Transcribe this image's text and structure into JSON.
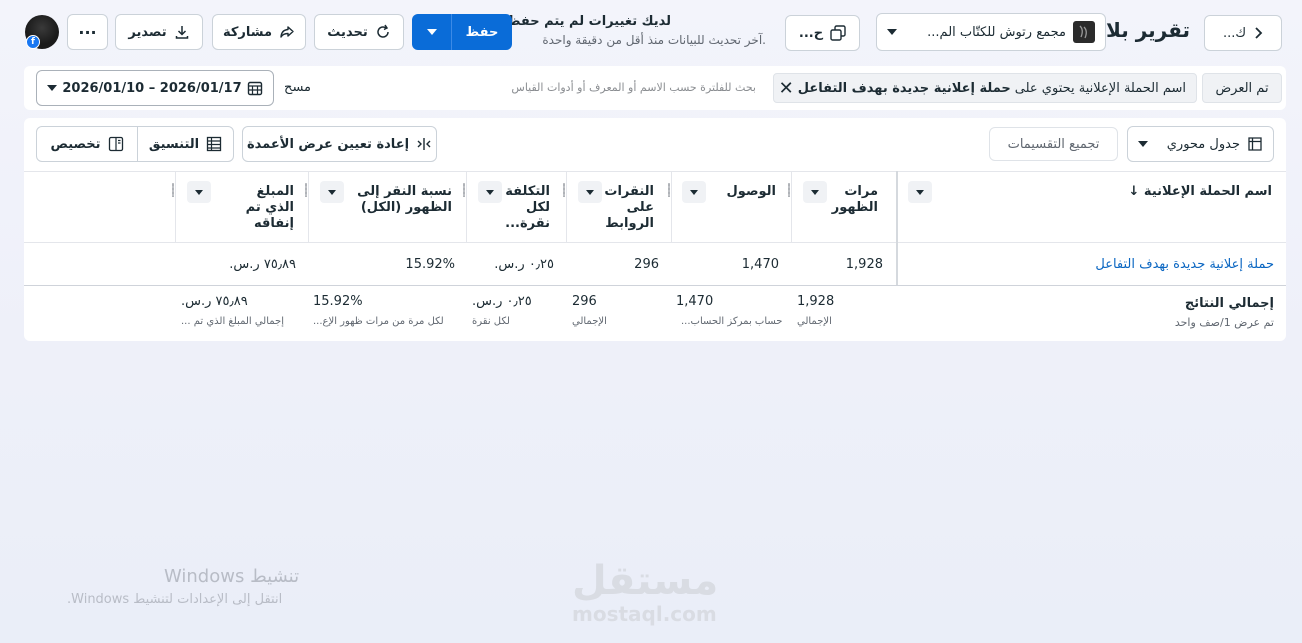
{
  "header": {
    "back_label": "ك...",
    "report_title": "تقرير بلا",
    "account_name": "مجمع رتوش للكتّاب الم...",
    "small_button_label": "ح...",
    "unsaved_title": "لديك تغييرات لم يتم حفظها",
    "unsaved_subtitle": "آخر تحديث للبيانات منذ أقل من دقيقة واحدة.",
    "save_label": "حفظ",
    "refresh_label": "تحديث",
    "share_label": "مشاركة",
    "export_label": "تصدير",
    "more_label": "···",
    "fb_badge": "f"
  },
  "filters": {
    "view_chip": "تم العرض",
    "filter_prefix": "اسم الحملة الإعلانية يحتوي على",
    "filter_value": "حملة إعلانية جديدة بهدف التفاعل",
    "filter_clear": "✕",
    "search_hint": "بحث للفلترة حسب الاسم أو المعرف أو أدوات القياس",
    "clear_label": "مسح",
    "date_range": "2026/01/10 – 2026/01/17"
  },
  "toolbar": {
    "pivot_label": "جدول محوري",
    "breakdown_label": "تجميع التقسيمات",
    "reset_columns_label": "إعادة تعيين عرض الأعمدة",
    "format_label": "التنسيق",
    "customize_label": "تخصيص"
  },
  "table": {
    "columns": [
      {
        "label": "اسم الحملة الإعلانية ↓"
      },
      {
        "label": "مرات الظهور"
      },
      {
        "label": "الوصول"
      },
      {
        "label": "النقرات على الروابط"
      },
      {
        "label": "التكلفة لكل نقرة..."
      },
      {
        "label": "نسبة النقر إلى الظهور (الكل)"
      },
      {
        "label": "المبلغ الذي تم إنفاقه"
      }
    ],
    "rows": [
      {
        "campaign": "حملة إعلانية جديدة بهدف التفاعل",
        "impressions": "1,928",
        "reach": "1,470",
        "link_clicks": "296",
        "cpc": "٠٫٢٥ ر.س.",
        "ctr": "15.92%",
        "spent": "٧٥٫٨٩ ر.س."
      }
    ],
    "totals": {
      "title": "إجمالي النتائج",
      "subtitle": "تم عرض 1/صف واحد",
      "impressions": "1,928",
      "impressions_sub": "الإجمالي",
      "reach": "1,470",
      "reach_sub": "حساب بمركز الحساب...",
      "link_clicks": "296",
      "link_clicks_sub": "الإجمالي",
      "cpc": "٠٫٢٥ ر.س.",
      "cpc_sub": "لكل نقرة",
      "ctr": "15.92%",
      "ctr_sub": "لكل مرة من مرات ظهور الإع...",
      "spent": "٧٥٫٨٩ ر.س.",
      "spent_sub": "إجمالي المبلغ الذي تم ..."
    }
  },
  "watermarks": {
    "windows_title": "تنشيط Windows",
    "windows_subtitle": "انتقل إلى الإعدادات لتنشيط Windows.",
    "logo_text": "مستقل",
    "logo_url": "mostaql.com"
  },
  "colors": {
    "primary": "#0a6cd8",
    "link": "#0a66c2",
    "facebook": "#1877f2"
  }
}
